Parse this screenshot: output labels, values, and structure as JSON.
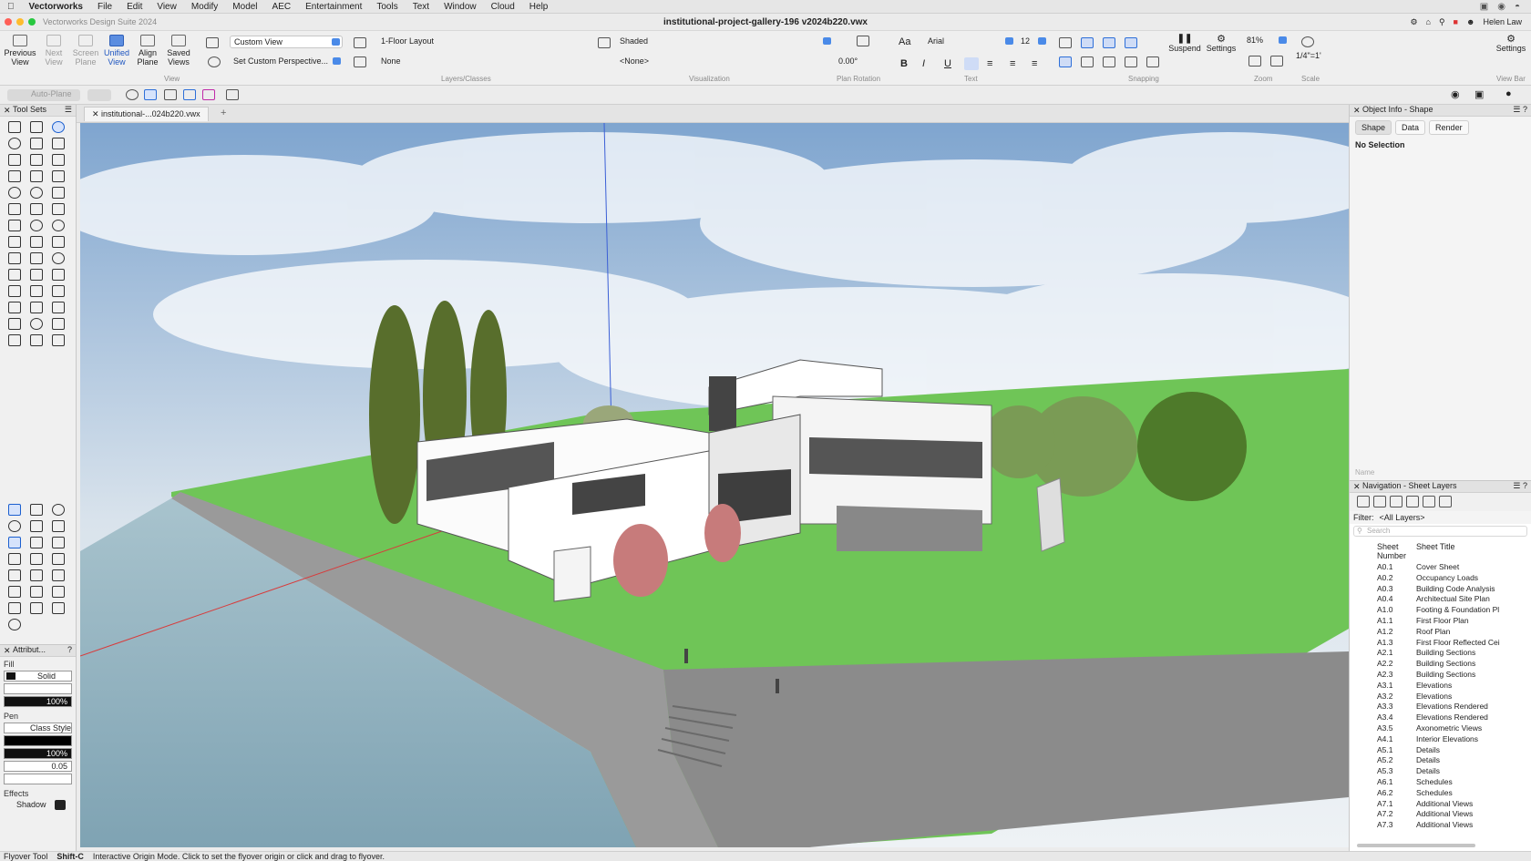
{
  "menubar": {
    "app": "Vectorworks",
    "items": [
      "File",
      "Edit",
      "View",
      "Modify",
      "Model",
      "AEC",
      "Entertainment",
      "Tools",
      "Text",
      "Window",
      "Cloud",
      "Help"
    ]
  },
  "titlebar": {
    "suite": "Vectorworks Design Suite 2024",
    "document": "institutional-project-gallery-196 v2024b220.vwx",
    "user": "Helen Law"
  },
  "toolbar": {
    "previous_view": "Previous View",
    "next_view": "Next View",
    "screen_plane": "Screen Plane",
    "unified_view": "Unified View",
    "align_plane": "Align Plane",
    "saved_views": "Saved Views",
    "view_mode": "Custom View",
    "perspective": "Set Custom Perspective...",
    "layer": "1-Floor Layout",
    "class": "None",
    "render_mode": "Shaded",
    "light_option": "<None>",
    "plan_rotation": "0.00°",
    "font": "Arial",
    "font_size": "12",
    "suspend": "Suspend",
    "settings": "Settings",
    "zoom": "81%",
    "scale": "1/4\"=1'",
    "settings_right": "Settings",
    "sections": {
      "view": "View",
      "layers_classes": "Layers/Classes",
      "visualization": "Visualization",
      "plan_rotation": "Plan Rotation",
      "text": "Text",
      "snapping": "Snapping",
      "zoom": "Zoom",
      "scale": "Scale",
      "view_bar": "View Bar"
    }
  },
  "row2": {
    "auto_plane": "Auto-Plane"
  },
  "toolsets": {
    "title": "Tool Sets"
  },
  "attributes": {
    "title": "Attribut...",
    "fill_label": "Fill",
    "fill_style": "Solid",
    "fill_opacity": "100%",
    "pen_label": "Pen",
    "pen_style": "Class Style",
    "pen_opacity": "100%",
    "line_weight": "0.05",
    "effects_label": "Effects",
    "shadow": "Shadow"
  },
  "tabs": {
    "doc_tab": "institutional-...024b220.vwx",
    "add": "+"
  },
  "object_info": {
    "title": "Object Info - Shape",
    "tabs": [
      "Shape",
      "Data",
      "Render"
    ],
    "selection": "No Selection",
    "name_label": "Name"
  },
  "navigation": {
    "title": "Navigation - Sheet Layers",
    "filter_label": "Filter:",
    "filter_value": "<All Layers>",
    "search_placeholder": "Search",
    "col_number": "Sheet Number",
    "col_title": "Sheet Title",
    "sheets": [
      {
        "num": "A0.1",
        "title": "Cover Sheet"
      },
      {
        "num": "A0.2",
        "title": "Occupancy Loads"
      },
      {
        "num": "A0.3",
        "title": "Building Code Analysis"
      },
      {
        "num": "A0.4",
        "title": "Architectual Site Plan"
      },
      {
        "num": "A1.0",
        "title": "Footing & Foundation Pl"
      },
      {
        "num": "A1.1",
        "title": "First Floor Plan"
      },
      {
        "num": "A1.2",
        "title": "Roof Plan"
      },
      {
        "num": "A1.3",
        "title": "First Floor Reflected Cei"
      },
      {
        "num": "A2.1",
        "title": "Building Sections"
      },
      {
        "num": "A2.2",
        "title": "Building Sections"
      },
      {
        "num": "A2.3",
        "title": "Building Sections"
      },
      {
        "num": "A3.1",
        "title": "Elevations"
      },
      {
        "num": "A3.2",
        "title": "Elevations"
      },
      {
        "num": "A3.3",
        "title": "Elevations Rendered"
      },
      {
        "num": "A3.4",
        "title": "Elevations Rendered"
      },
      {
        "num": "A3.5",
        "title": "Axonometric Views"
      },
      {
        "num": "A4.1",
        "title": "Interior Elevations"
      },
      {
        "num": "A5.1",
        "title": "Details"
      },
      {
        "num": "A5.2",
        "title": "Details"
      },
      {
        "num": "A5.3",
        "title": "Details"
      },
      {
        "num": "A6.1",
        "title": "Schedules"
      },
      {
        "num": "A6.2",
        "title": "Schedules"
      },
      {
        "num": "A7.1",
        "title": "Additional Views"
      },
      {
        "num": "A7.2",
        "title": "Additional Views"
      },
      {
        "num": "A7.3",
        "title": "Additional Views"
      }
    ]
  },
  "status": {
    "tool": "Flyover Tool",
    "shortcut": "Shift-C",
    "message": "Interactive Origin Mode. Click to set the flyover origin or click and drag to flyover."
  },
  "colors": {
    "accent": "#2e6fd8",
    "grass": "#6fc557",
    "water": "#8fb2c2",
    "sky": "#b9cfe3"
  }
}
